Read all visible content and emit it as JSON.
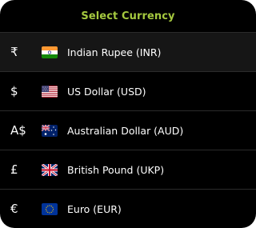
{
  "header": {
    "title": "Select Currency",
    "title_color": "#a5c93f"
  },
  "currencies": [
    {
      "symbol": "₹",
      "name": "Indian Rupee (INR)",
      "flag": "india-flag-icon",
      "selected": true
    },
    {
      "symbol": "$",
      "name": "US Dollar (USD)",
      "flag": "usa-flag-icon",
      "selected": false
    },
    {
      "symbol": "A$",
      "name": "Australian Dollar (AUD)",
      "flag": "australia-flag-icon",
      "selected": false
    },
    {
      "symbol": "£",
      "name": "British Pound (UKP)",
      "flag": "uk-flag-icon",
      "selected": false
    },
    {
      "symbol": "€",
      "name": "Euro (EUR)",
      "flag": "eu-flag-icon",
      "selected": false
    }
  ],
  "colors": {
    "background": "#000000",
    "selected_row": "#161616",
    "divider": "#2b2b2b",
    "text": "#ffffff"
  }
}
